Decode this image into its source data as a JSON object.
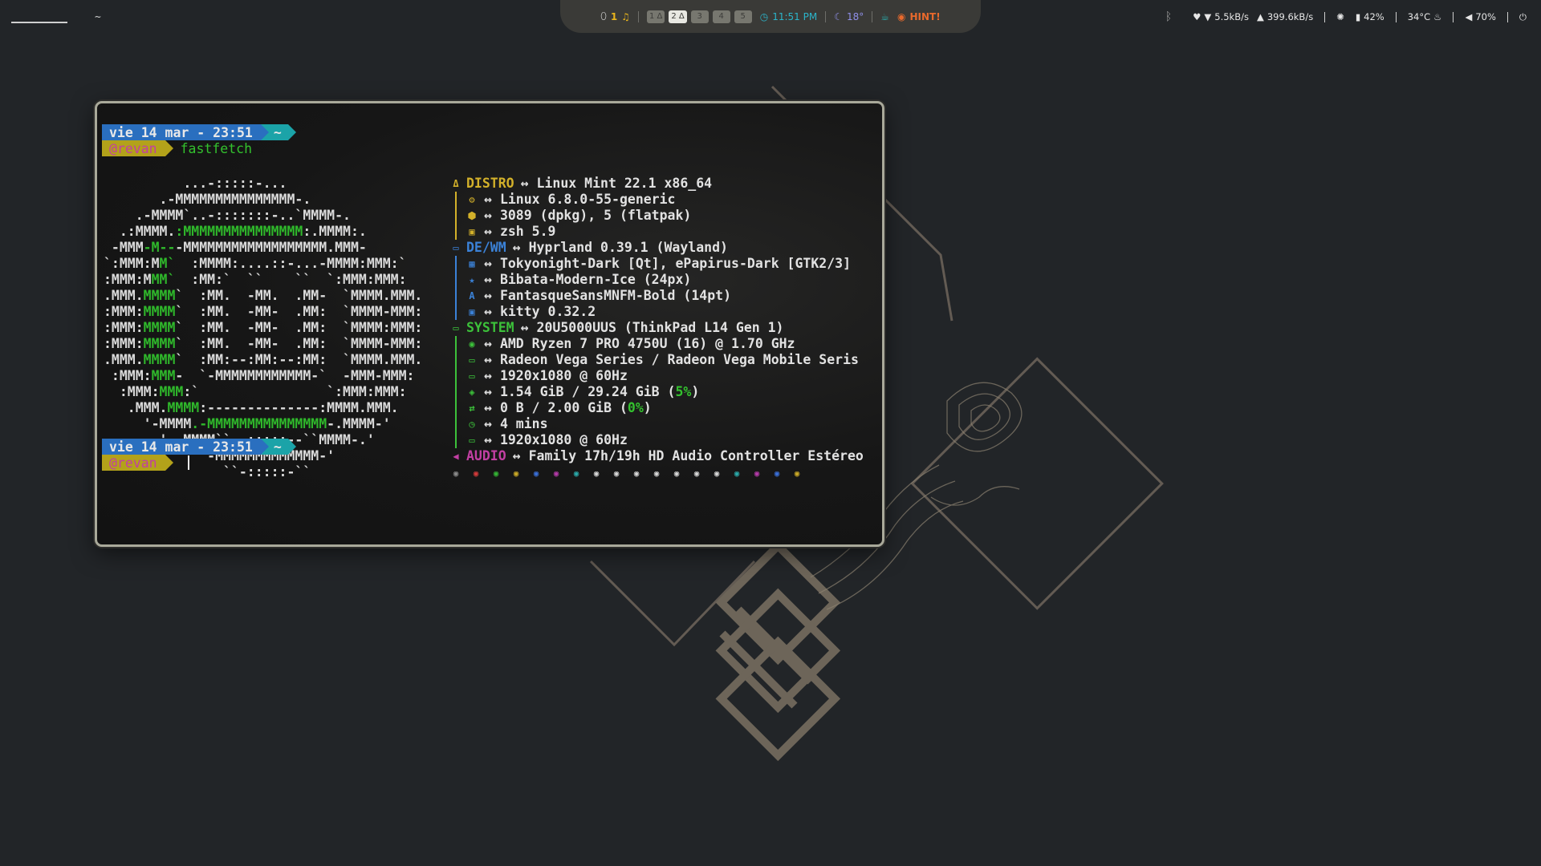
{
  "topbar": {
    "left": {
      "active_workspace_underline": "",
      "workspace_tilde": "~"
    },
    "center": {
      "notif_count": "1",
      "workspaces": [
        "1 Δ",
        "2 Δ",
        "3",
        "4",
        "5"
      ],
      "active_workspace_index": 1,
      "clock": "11:51 PM",
      "weather": "18°",
      "hint": "HINT!"
    },
    "right": {
      "download": "5.5kB/s",
      "upload": "399.6kB/s",
      "brightness": "42%",
      "temperature": "34°C",
      "volume": "70%"
    }
  },
  "terminal": {
    "prompt1": {
      "date": "vie 14 mar - 23:51",
      "home": "~",
      "user": "@revan",
      "command": "fastfetch"
    },
    "prompt2": {
      "date": "vie 14 mar - 23:51",
      "home": "~",
      "user": "@revan",
      "command": ""
    },
    "ascii_art": [
      "          ...-:::::-...",
      "       .-MMMMMMMMMMMMMMM-.",
      "    .-MMMM`..-:::::::-..`MMMM-.",
      "  .:MMMM.:MMMMMMMMMMMMMMM:.MMMM:.",
      " -MMM-M---MMMMMMMMMMMMMMMMMM.MMM-",
      "`:MMM:MM`  :MMMM:....::-...-MMMM:MMM:`",
      ":MMM:MMM`  :MM:`  ``    ``  `:MMM:MMM:",
      ".MMM.MMMM`  :MM.  -MM.  .MM-  `MMMM.MMM.",
      ":MMM:MMMM`  :MM.  -MM-  .MM:  `MMMM-MMM:",
      ":MMM:MMMM`  :MM.  -MM-  .MM:  `MMMM:MMM:",
      ":MMM:MMMM`  :MM.  -MM-  .MM:  `MMMM-MMM:",
      ".MMM.MMMM`  :MM:--:MM:--:MM:  `MMMM.MMM.",
      " :MMM:MMM-  `-MMMMMMMMMMMM-`  -MMM-MMM:",
      "  :MMM:MMM:`                `:MMM:MMM:",
      "   .MMM.MMMM:--------------:MMMM.MMM.",
      "     '-MMMM.-MMMMMMMMMMMMMMM-.MMMM-'",
      "       '.-MMMM``--:::::--``MMMM-.'",
      "            '-MMMMMMMMMMMMM-'",
      "               ``-:::::-``"
    ],
    "info": {
      "distro": {
        "label": "DISTRO",
        "value": "Linux Mint 22.1 x86_64"
      },
      "distro_items": [
        {
          "icon": "settings-icon",
          "value": "Linux 6.8.0-55-generic"
        },
        {
          "icon": "package-icon",
          "value": "3089 (dpkg), 5 (flatpak)"
        },
        {
          "icon": "terminal-icon",
          "value": "zsh 5.9"
        }
      ],
      "dewm": {
        "label": "DE/WM",
        "value": "Hyprland 0.39.1 (Wayland)"
      },
      "dewm_items": [
        {
          "icon": "theme-icon",
          "value": "Tokyonight-Dark [Qt], ePapirus-Dark [GTK2/3]"
        },
        {
          "icon": "cursor-icon",
          "value": "Bibata-Modern-Ice (24px)"
        },
        {
          "icon": "font-icon",
          "value": "FantasqueSansMNFM-Bold (14pt)"
        },
        {
          "icon": "terminal-icon",
          "value": "kitty 0.32.2"
        }
      ],
      "system": {
        "label": "SYSTEM",
        "value": "20U5000UUS (ThinkPad L14 Gen 1)"
      },
      "system_items": [
        {
          "icon": "cpu-icon",
          "value": "AMD Ryzen 7 PRO 4750U (16) @ 1.70 GHz"
        },
        {
          "icon": "gpu-icon",
          "value": "Radeon Vega Series / Radeon Vega Mobile Seris"
        },
        {
          "icon": "monitor-icon",
          "value": "1920x1080 @ 60Hz"
        },
        {
          "icon": "memory-icon",
          "value_prefix": "1.54 GiB / 29.24 GiB (",
          "value_pct": "5%",
          "value_suffix": ")"
        },
        {
          "icon": "swap-icon",
          "value_prefix": "0 B / 2.00 GiB (",
          "value_pct": "0%",
          "value_suffix": ")"
        },
        {
          "icon": "clock-icon",
          "value": "4 mins"
        },
        {
          "icon": "monitor-icon",
          "value": "1920x1080 @ 60Hz"
        }
      ],
      "audio": {
        "label": "AUDIO",
        "value": "Family 17h/19h HD Audio Controller Estéreo"
      },
      "color_dots": [
        "#8a8a8a",
        "#d23a3a",
        "#34b334",
        "#c9a827",
        "#3a6fd8",
        "#b43aa8",
        "#2aa8a8",
        "#d6d6d6",
        "#d6d6d6",
        "#d6d6d6",
        "#d6d6d6",
        "#d6d6d6",
        "#d6d6d6",
        "#d6d6d6",
        "#2aa8a8",
        "#b43aa8",
        "#3a6fd8",
        "#c9a827"
      ]
    }
  }
}
